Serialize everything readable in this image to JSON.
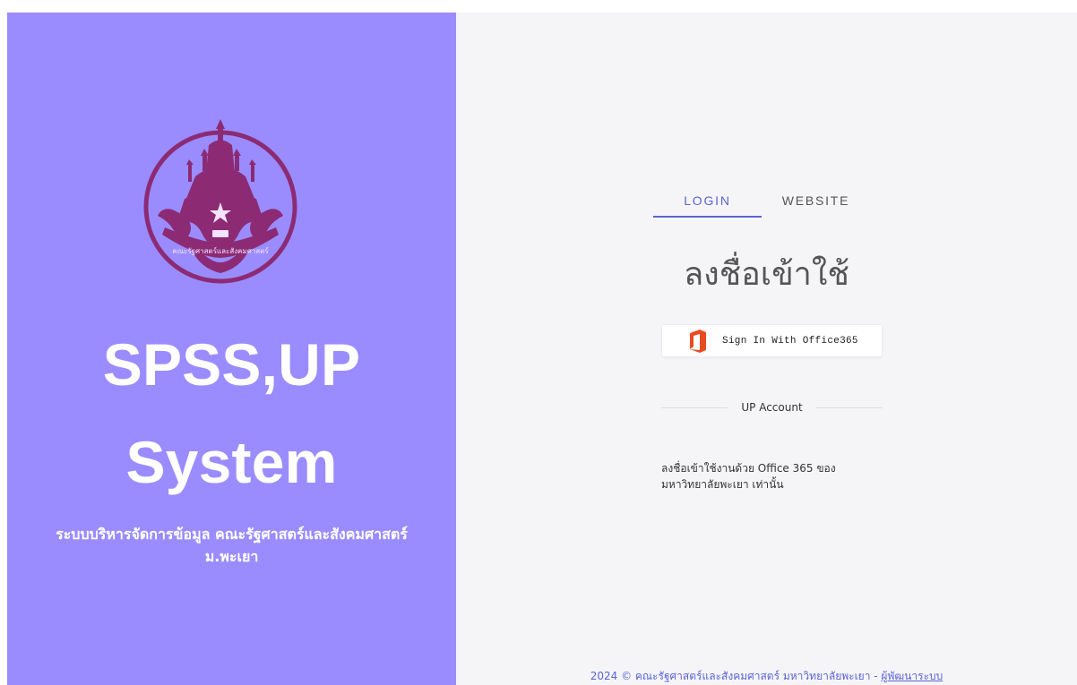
{
  "left": {
    "title_line_1": "SPSS,UP",
    "title_line_2": "System",
    "subtitle_line_1": "ระบบบริหารจัดการข้อมูล คณะรัฐศาสตร์และสังคมศาสตร์",
    "subtitle_line_2": "ม.พะเยา",
    "logo_text": "คณะรัฐศาสตร์และสังคมศาสตร์"
  },
  "tabs": [
    {
      "label": "LOGIN",
      "active": true
    },
    {
      "label": "WEBSITE",
      "active": false
    }
  ],
  "login": {
    "heading": "ลงชื่อเข้าใช้",
    "office_button_label": "Sign In With Office365",
    "divider_label": "UP Account",
    "note_line_1": "ลงชื่อเข้าใช้งานด้วย Office 365 ของ",
    "note_line_2": "มหาวิทยาลัยพะเยา เท่านั้น"
  },
  "footer": {
    "text": "2024 © คณะรัฐศาสตร์และสังคมศาสตร์ มหาวิทยาลัยพะเยา - ",
    "link": "ผู้พัฒนาระบบ"
  },
  "colors": {
    "left_panel": "#9a8cff",
    "logo": "#8c2b74",
    "accent": "#5b63d6",
    "office": "#e84b1f"
  },
  "icons": {
    "logo": "faculty-logo-icon",
    "office": "office365-icon"
  }
}
